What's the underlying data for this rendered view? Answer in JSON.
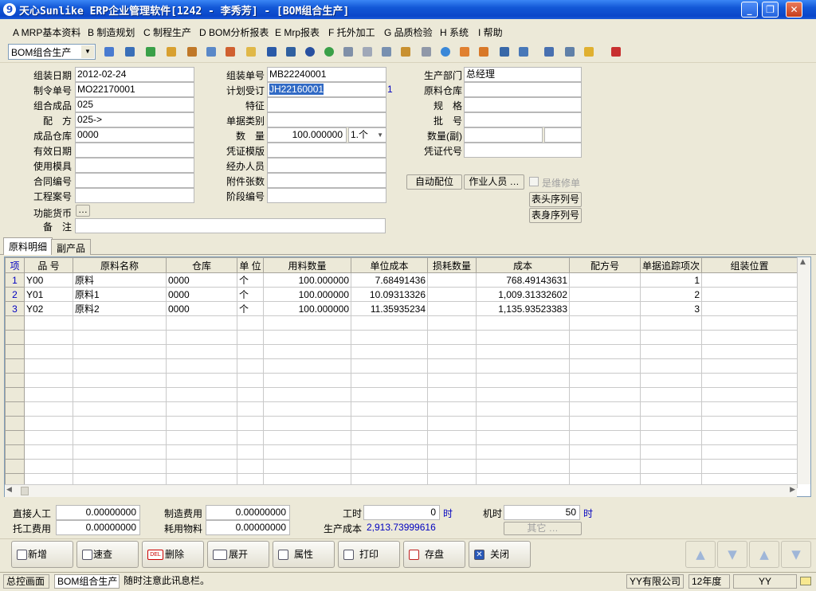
{
  "window": {
    "title": "天心Sunlike ERP企业管理软件[1242 - 李秀芳] - [BOM组合生产]"
  },
  "menu": [
    "A MRP基本资料",
    "B 制造规划",
    "C 制程生产",
    "D BOM分析报表",
    "E Mrp报表",
    "F 托外加工",
    "G 品质检验",
    "H 系统",
    "I 帮助"
  ],
  "toolbar": {
    "mode": "BOM组合生产"
  },
  "form": {
    "assemble_date": {
      "label": "组装日期",
      "value": "2012-02-24"
    },
    "order_no": {
      "label": "制令单号",
      "value": "MO22170001"
    },
    "product": {
      "label": "组合成品",
      "value": "025"
    },
    "formula": {
      "label": "配　方",
      "value": "025->"
    },
    "warehouse": {
      "label": "成品仓库",
      "value": "0000"
    },
    "valid_date": {
      "label": "有效日期",
      "value": ""
    },
    "mold": {
      "label": "使用模具",
      "value": ""
    },
    "contract": {
      "label": "合同编号",
      "value": ""
    },
    "project": {
      "label": "工程案号",
      "value": ""
    },
    "currency": {
      "label": "功能货币",
      "value": ""
    },
    "remark": {
      "label": "备　注",
      "value": ""
    },
    "assemble_no": {
      "label": "组装单号",
      "value": "MB22240001"
    },
    "plan_no": {
      "label": "计划受订",
      "value": "JH22160001",
      "suffix": "1"
    },
    "feature": {
      "label": "特征",
      "value": ""
    },
    "doc_type": {
      "label": "单据类别",
      "value": ""
    },
    "quantity": {
      "label": "数　量",
      "value": "100.000000",
      "unit": "1.个"
    },
    "voucher_tpl": {
      "label": "凭证模版",
      "value": ""
    },
    "handler": {
      "label": "经办人员",
      "value": ""
    },
    "attachments": {
      "label": "附件张数",
      "value": ""
    },
    "stage": {
      "label": "阶段编号",
      "value": ""
    },
    "dept": {
      "label": "生产部门",
      "value": "总经理"
    },
    "mat_wh": {
      "label": "原料仓库",
      "value": ""
    },
    "spec": {
      "label": "规　格",
      "value": ""
    },
    "batch": {
      "label": "批　号",
      "value": ""
    },
    "qty_sub": {
      "label": "数量(副)",
      "value": ""
    },
    "voucher_code": {
      "label": "凭证代号",
      "value": ""
    },
    "btn_auto": "自动配位",
    "btn_worker": "作业人员 …",
    "chk_repair": "是维修单",
    "btn_header_seq": "表头序列号",
    "btn_body_seq": "表身序列号"
  },
  "tabs": [
    "原料明细",
    "副产品"
  ],
  "grid": {
    "columns": [
      "项",
      "品 号",
      "原料名称",
      "仓库",
      "单 位",
      "用料数量",
      "单位成本",
      "损耗数量",
      "成本",
      "配方号",
      "单据追踪项次",
      "组装位置"
    ],
    "rows": [
      [
        "1",
        "Y00",
        "原料",
        "0000",
        "个",
        "100.000000",
        "7.68491436",
        "",
        "768.49143631",
        "",
        "1",
        ""
      ],
      [
        "2",
        "Y01",
        "原料1",
        "0000",
        "个",
        "100.000000",
        "10.09313326",
        "",
        "1,009.31332602",
        "",
        "2",
        ""
      ],
      [
        "3",
        "Y02",
        "原料2",
        "0000",
        "个",
        "100.000000",
        "11.35935234",
        "",
        "1,135.93523383",
        "",
        "3",
        ""
      ]
    ]
  },
  "footer": {
    "direct_labor": {
      "label": "直接人工",
      "value": "0.00000000"
    },
    "mfg_cost": {
      "label": "制造费用",
      "value": "0.00000000"
    },
    "work_hours": {
      "label": "工时",
      "value": "0",
      "unit": "时"
    },
    "machine_hours": {
      "label": "机时",
      "value": "50",
      "unit": "时"
    },
    "outsource": {
      "label": "托工费用",
      "value": "0.00000000"
    },
    "consumables": {
      "label": "耗用物料",
      "value": "0.00000000"
    },
    "prod_cost": {
      "label": "生产成本",
      "value": "2,913.73999616"
    },
    "other": "其它 …"
  },
  "actions": [
    "新增",
    "速查",
    "删除",
    "展开",
    "属性",
    "打印",
    "存盘",
    "关闭"
  ],
  "status": {
    "home": "总控画面",
    "module": "BOM组合生产",
    "message": "随时注意此讯息栏。",
    "company": "YY有限公司",
    "year": "12年度",
    "user": "YY"
  }
}
